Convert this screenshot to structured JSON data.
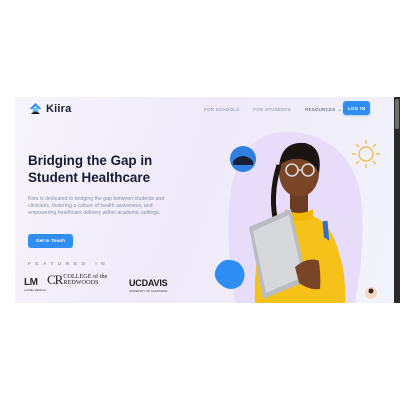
{
  "brand": {
    "name": "Kiira",
    "accent": "#2f8ef4"
  },
  "nav": {
    "links": [
      "FOR SCHOOLS",
      "FOR STUDENTS"
    ],
    "resources_label": "RESOURCES",
    "login_label": "LOG IN"
  },
  "hero": {
    "headline": "Bridging the Gap in Student Healthcare",
    "description": "Kiira is dedicated to bridging the gap between students and clinicians, fostering a culture of health awareness, and empowering healthcare delivery within academic settings.",
    "cta_label": "Get In Touch",
    "featured_label": "FEATURED IN"
  },
  "partners": {
    "lm": {
      "big": "LM",
      "small": "LAUREL MEDICAL"
    },
    "redwoods": {
      "big": "CR",
      "line1": "COLLEGE of the",
      "line2": "REDWOODS"
    },
    "ucdavis": {
      "big": "UCDAVIS",
      "small": "UNIVERSITY OF CALIFORNIA"
    }
  },
  "icons": [
    "kiira-logo-icon",
    "chevron-down-icon",
    "sun-icon",
    "student-illustration"
  ]
}
